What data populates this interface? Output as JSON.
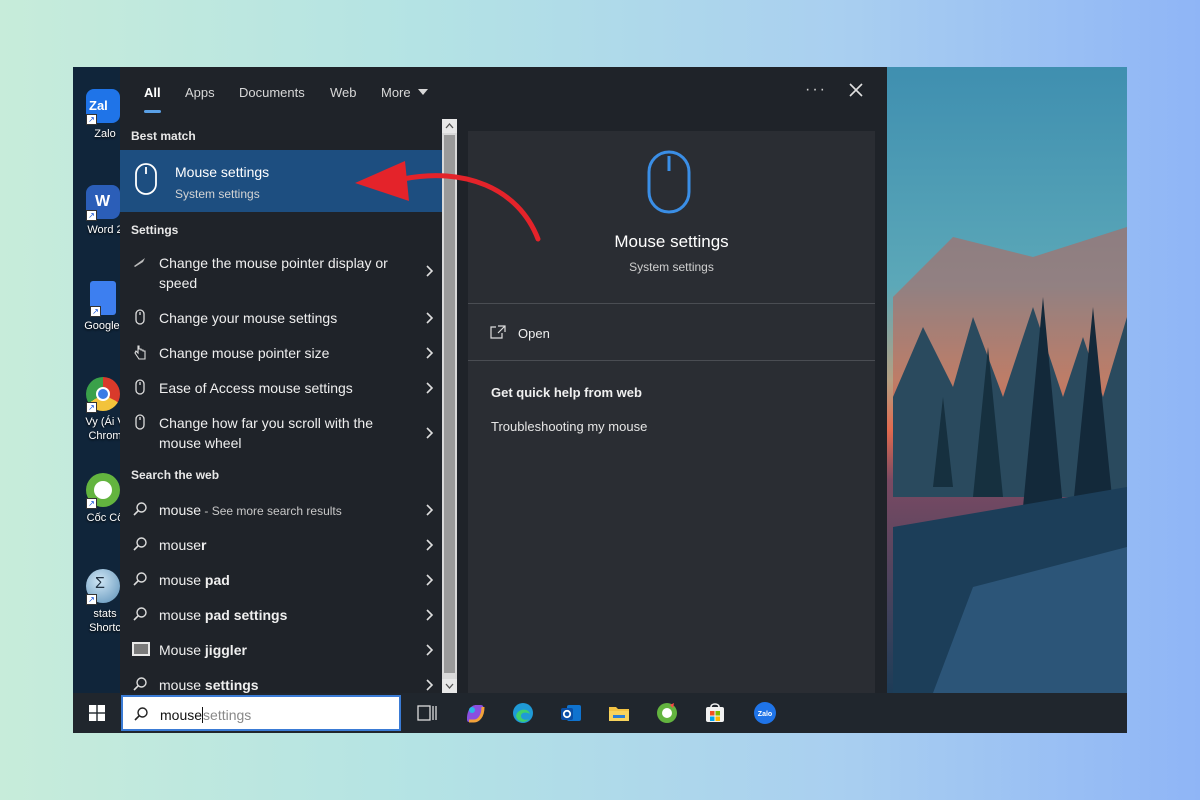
{
  "tabs": [
    {
      "label": "All",
      "active": true
    },
    {
      "label": "Apps",
      "active": false
    },
    {
      "label": "Documents",
      "active": false
    },
    {
      "label": "Web",
      "active": false
    },
    {
      "label": "More",
      "active": false
    }
  ],
  "more_dots": "···",
  "best_match": {
    "heading": "Best match",
    "title": "Mouse settings",
    "subtitle": "System settings"
  },
  "settings": {
    "heading": "Settings",
    "items": [
      {
        "icon": "mouse-pointer-icon",
        "line1": "Change the mouse pointer display or",
        "line2": "speed"
      },
      {
        "icon": "mouse-icon",
        "line1": "Change your mouse settings",
        "line2": ""
      },
      {
        "icon": "hand-pointer-icon",
        "line1": "Change mouse pointer size",
        "line2": ""
      },
      {
        "icon": "mouse-icon",
        "line1": "Ease of Access mouse settings",
        "line2": ""
      },
      {
        "icon": "mouse-icon",
        "line1": "Change how far you scroll with the",
        "line2": "mouse wheel"
      }
    ]
  },
  "web": {
    "heading": "Search the web",
    "items": [
      {
        "prefix": "mouse",
        "bold": "",
        "suffix": " - See more search results"
      },
      {
        "prefix": "mouse",
        "bold": "r",
        "suffix": ""
      },
      {
        "prefix": "mouse ",
        "bold": "pad",
        "suffix": ""
      },
      {
        "prefix": "mouse ",
        "bold": "pad settings",
        "suffix": ""
      },
      {
        "prefix": "Mouse ",
        "bold": "jiggler",
        "suffix": ""
      },
      {
        "prefix": "mouse ",
        "bold": "settings",
        "suffix": ""
      }
    ]
  },
  "detail": {
    "title": "Mouse settings",
    "subtitle": "System settings",
    "open_label": "Open",
    "help_heading": "Get quick help from web",
    "help_link": "Troubleshooting my mouse"
  },
  "desktop_icons": [
    {
      "name": "zalo",
      "label": "Zalo",
      "color": "#1f74e8"
    },
    {
      "name": "word",
      "label": "Word 2",
      "color": "#2b5eb8"
    },
    {
      "name": "google-docs",
      "label": "Google I",
      "color": "#3d7ff0"
    },
    {
      "name": "chrome",
      "label1": "Vy (Ái V",
      "label2": "Chrom",
      "color": "#d93a2b"
    },
    {
      "name": "coc-coc",
      "label": "Cốc Cố",
      "color": "#63b43f"
    },
    {
      "name": "stats",
      "label1": "stats",
      "label2": "Shortc",
      "color": "#5a8fb7"
    }
  ],
  "search_box": {
    "typed": "mouse",
    "suggestion": "settings"
  },
  "colors": {
    "accent": "#5aa0e6",
    "selection": "#1d4e80",
    "panel": "#1f2329",
    "taskbar": "#20262d"
  }
}
